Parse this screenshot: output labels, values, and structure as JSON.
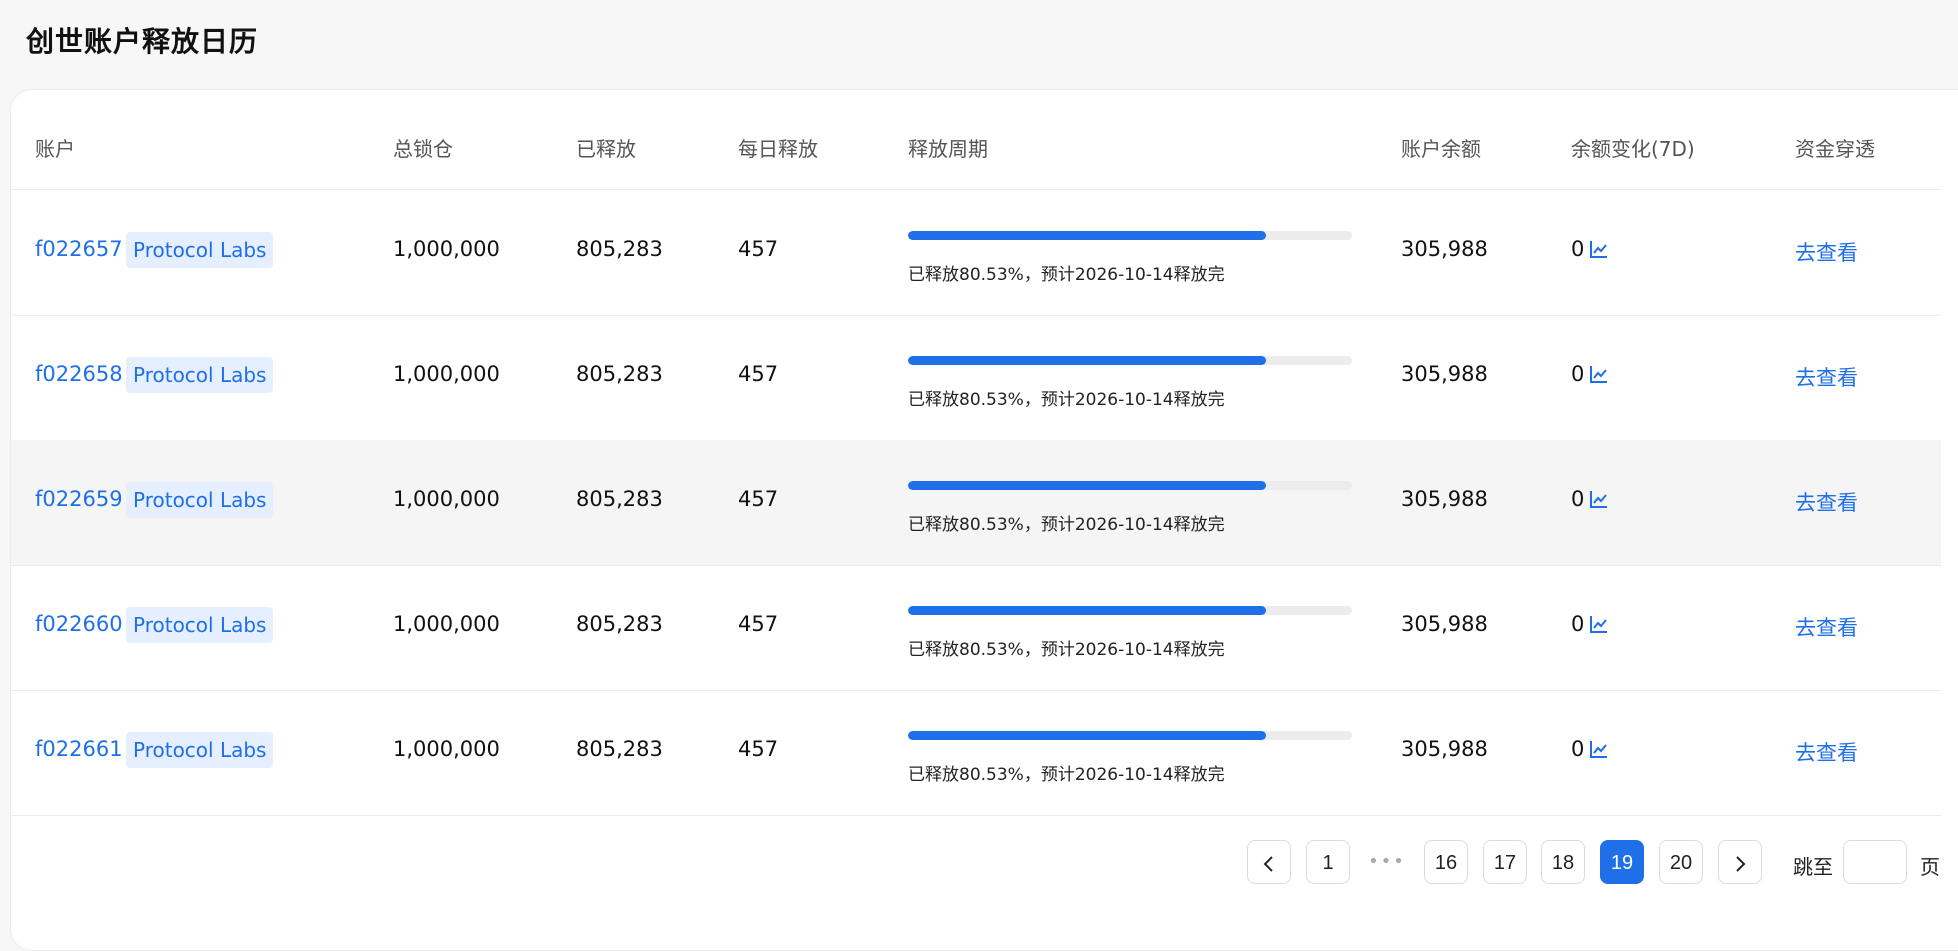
{
  "page": {
    "title": "创世账户释放日历"
  },
  "table": {
    "columns": [
      "账户",
      "总锁仓",
      "已释放",
      "每日释放",
      "释放周期",
      "账户余额",
      "余额变化(7D)",
      "资金穿透"
    ],
    "rows": [
      {
        "account": "f022657",
        "tag": "Protocol Labs",
        "total_locked": "1,000,000",
        "released": "805,283",
        "daily_release": "457",
        "progress": 80.53,
        "progress_text": "已释放80.53%，预计2026-10-14释放完",
        "balance": "305,988",
        "change_7d": "0",
        "action": "去查看"
      },
      {
        "account": "f022658",
        "tag": "Protocol Labs",
        "total_locked": "1,000,000",
        "released": "805,283",
        "daily_release": "457",
        "progress": 80.53,
        "progress_text": "已释放80.53%，预计2026-10-14释放完",
        "balance": "305,988",
        "change_7d": "0",
        "action": "去查看"
      },
      {
        "account": "f022659",
        "tag": "Protocol Labs",
        "total_locked": "1,000,000",
        "released": "805,283",
        "daily_release": "457",
        "progress": 80.53,
        "progress_text": "已释放80.53%，预计2026-10-14释放完",
        "balance": "305,988",
        "change_7d": "0",
        "action": "去查看"
      },
      {
        "account": "f022660",
        "tag": "Protocol Labs",
        "total_locked": "1,000,000",
        "released": "805,283",
        "daily_release": "457",
        "progress": 80.53,
        "progress_text": "已释放80.53%，预计2026-10-14释放完",
        "balance": "305,988",
        "change_7d": "0",
        "action": "去查看"
      },
      {
        "account": "f022661",
        "tag": "Protocol Labs",
        "total_locked": "1,000,000",
        "released": "805,283",
        "daily_release": "457",
        "progress": 80.53,
        "progress_text": "已释放80.53%，预计2026-10-14释放完",
        "balance": "305,988",
        "change_7d": "0",
        "action": "去查看"
      }
    ],
    "highlighted_row": 2
  },
  "pagination": {
    "prev_icon": "chevron-left-icon",
    "next_icon": "chevron-right-icon",
    "first": "1",
    "ellipsis": "•••",
    "pages": [
      "16",
      "17",
      "18",
      "19",
      "20"
    ],
    "current": "19",
    "jump_label": "跳至",
    "jump_suffix": "页"
  },
  "colors": {
    "accent": "#1f6fe8",
    "tag_bg": "#e6efff",
    "track": "#ececec"
  }
}
